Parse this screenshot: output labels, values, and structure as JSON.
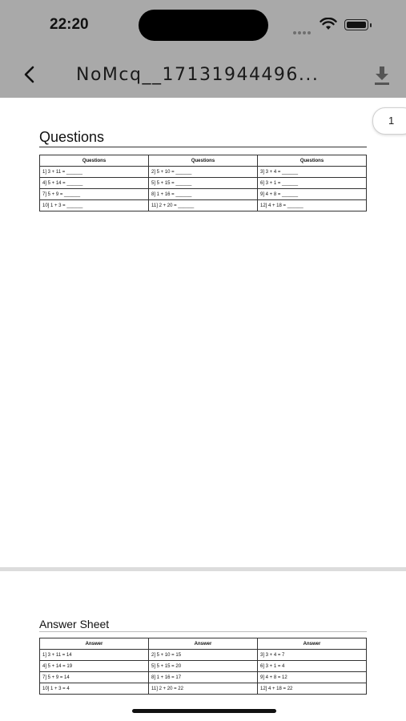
{
  "status_bar": {
    "time": "22:20"
  },
  "app_bar": {
    "title": "NoMcq__17131944496..."
  },
  "page_indicator": "1",
  "questions": {
    "title": "Questions",
    "headers": [
      "Questions",
      "Questions",
      "Questions"
    ],
    "rows": [
      [
        "1] 3 + 11 = ______",
        "2] 5 + 10 = ______",
        "3] 3 + 4 = ______"
      ],
      [
        "4] 5 + 14 = ______",
        "5] 5 + 15 = ______",
        "6] 3 + 1 = ______"
      ],
      [
        "7] 5 + 9 = ______",
        "8] 1 + 16 = ______",
        "9] 4 + 8 = ______"
      ],
      [
        "10] 1 + 3 = ______",
        "11] 2 + 20 = ______",
        "12] 4 + 18 = ______"
      ]
    ]
  },
  "answers": {
    "title": "Answer Sheet",
    "headers": [
      "Answer",
      "Answer",
      "Answer"
    ],
    "rows": [
      [
        "1] 3 + 11 = 14",
        "2] 5 + 10 = 15",
        "3] 3 + 4 = 7"
      ],
      [
        "4] 5 + 14 = 19",
        "5] 5 + 15 = 20",
        "6] 3 + 1 = 4"
      ],
      [
        "7] 5 + 9 = 14",
        "8] 1 + 16 = 17",
        "9] 4 + 8 = 12"
      ],
      [
        "10] 1 + 3 = 4",
        "11] 2 + 20 = 22",
        "12] 4 + 18 = 22"
      ]
    ]
  },
  "icons": {
    "back": "chevron-left-icon",
    "download": "download-icon",
    "wifi": "wifi-icon",
    "battery": "battery-icon",
    "signal": "cellular-signal-icon"
  }
}
